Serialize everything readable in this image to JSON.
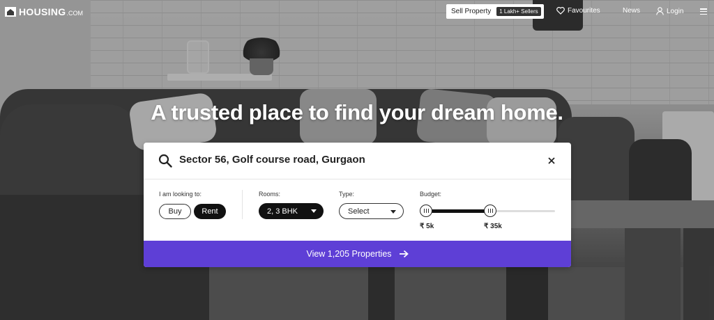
{
  "header": {
    "logo_text": "HOUSING",
    "logo_suffix": ".COM",
    "sell_label": "Sell Property",
    "sell_badge": "1 Lakh+ Sellers",
    "favourites_label": "Favourites",
    "news_label": "News",
    "login_label": "Login"
  },
  "hero": {
    "title": "A trusted place to find your dream home."
  },
  "search": {
    "value": "Sector 56, Golf course road, Gurgaon"
  },
  "filters": {
    "looking_label": "I am looking to:",
    "buy_label": "Buy",
    "rent_label": "Rent",
    "rooms_label": "Rooms:",
    "rooms_value": "2, 3 BHK",
    "type_label": "Type:",
    "type_value": "Select",
    "budget_label": "Budget:",
    "budget_min": "₹ 5k",
    "budget_max": "₹ 35k",
    "selected_intent": "Rent"
  },
  "cta": {
    "label": "View 1,205 Properties"
  },
  "colors": {
    "accent": "#5e3fd6",
    "active_pill": "#111111"
  }
}
